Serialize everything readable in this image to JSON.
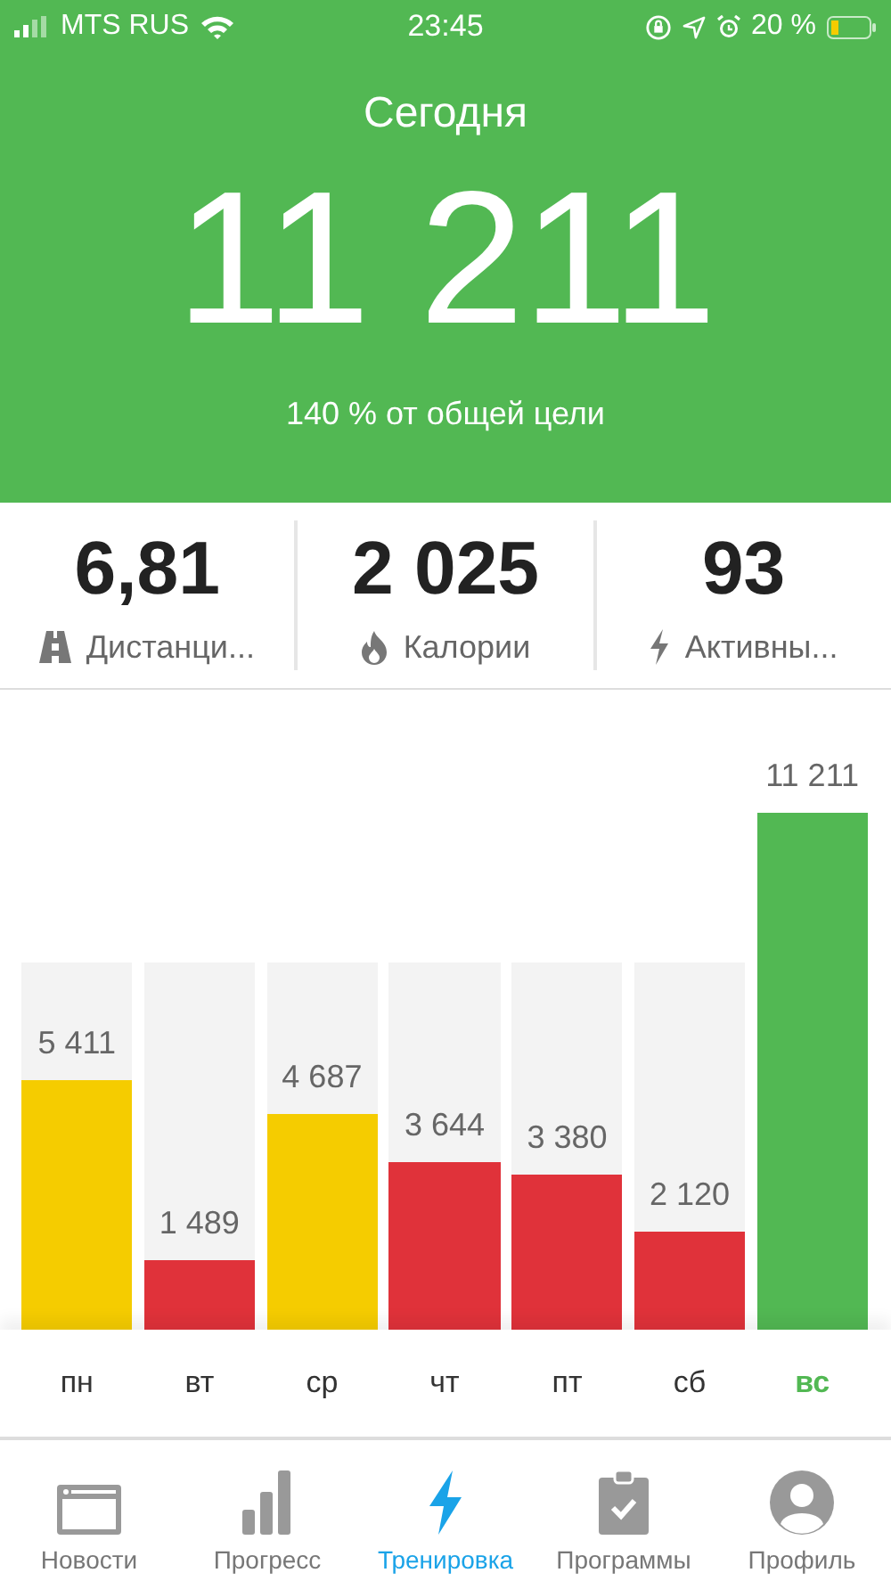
{
  "status_bar": {
    "carrier": "MTS RUS",
    "time": "23:45",
    "battery": "20 %"
  },
  "today": {
    "title": "Сегодня",
    "steps": "11 211",
    "goal": "140 % от общей цели"
  },
  "stats": [
    {
      "kind": "road",
      "value": "6,81",
      "label": "Дистанци..."
    },
    {
      "kind": "flame",
      "value": "2 025",
      "label": "Калории"
    },
    {
      "kind": "bolt",
      "value": "93",
      "label": "Активны..."
    }
  ],
  "days": [
    {
      "label": "пн",
      "value": "5 411",
      "color": "#f5cc00",
      "selected": false
    },
    {
      "label": "вт",
      "value": "1 489",
      "color": "#e0323a",
      "selected": false
    },
    {
      "label": "ср",
      "value": "4 687",
      "color": "#f5cc00",
      "selected": false
    },
    {
      "label": "чт",
      "value": "3 644",
      "color": "#e0323a",
      "selected": false
    },
    {
      "label": "пт",
      "value": "3 380",
      "color": "#e0323a",
      "selected": false
    },
    {
      "label": "сб",
      "value": "2 120",
      "color": "#e0323a",
      "selected": false
    },
    {
      "label": "вс",
      "value": "11 211",
      "color": "#52b853",
      "selected": true
    }
  ],
  "tabs": [
    {
      "kind": "news",
      "label": "Новости",
      "selected": false
    },
    {
      "kind": "progress",
      "label": "Прогресс",
      "selected": false
    },
    {
      "kind": "training",
      "label": "Тренировка",
      "selected": true
    },
    {
      "kind": "programs",
      "label": "Программы",
      "selected": false
    },
    {
      "kind": "profile",
      "label": "Профиль",
      "selected": false
    }
  ]
}
